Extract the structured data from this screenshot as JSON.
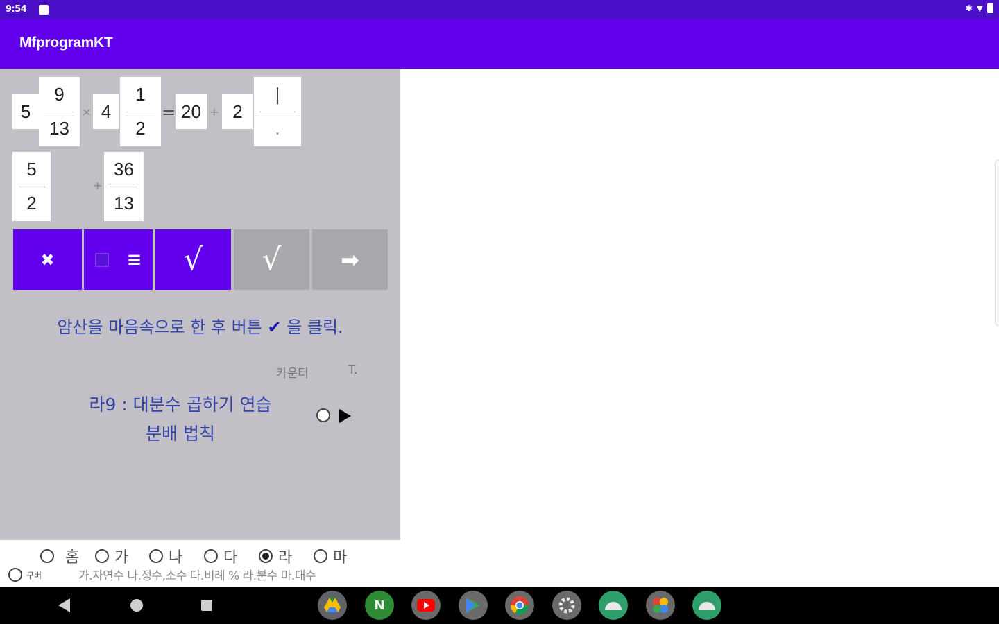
{
  "status_bar": {
    "time": "9:54"
  },
  "app": {
    "title": "MfprogramKT"
  },
  "equation": {
    "lhs1": {
      "whole": "5",
      "num": "9",
      "den": "13"
    },
    "times": "×",
    "lhs2": {
      "whole": "4",
      "num": "1",
      "den": "2"
    },
    "equals": "=",
    "result_whole": "20",
    "plus": "+",
    "rhs": {
      "whole": "2",
      "num": "|",
      "den": "."
    },
    "row2_frac1": {
      "num": "5",
      "den": "2"
    },
    "row2_plus": "+",
    "row2_frac2": {
      "num": "36",
      "den": "13"
    }
  },
  "buttons": {
    "clear": "✖",
    "menu": "≡",
    "check": "√",
    "check2": "√",
    "next": "➡"
  },
  "hint": {
    "text_before": "암산을 마음속으로 한 후 버튼",
    "check_mark": "✔",
    "text_after": "을 클릭."
  },
  "labels": {
    "counter": "카운터",
    "t": "T."
  },
  "lesson": {
    "line1": "라9 : 대분수 곱하기 연습",
    "line2": "분배 법칙"
  },
  "categories": [
    {
      "label": "홈",
      "checked": false
    },
    {
      "label": "가",
      "checked": false
    },
    {
      "label": "나",
      "checked": false
    },
    {
      "label": "다",
      "checked": false
    },
    {
      "label": "라",
      "checked": true
    },
    {
      "label": "마",
      "checked": false
    }
  ],
  "small_option": "구버",
  "legend": "가.자연수 나.정수,소수 다.비례 % 라.분수 마.대수",
  "dock": [
    {
      "name": "drive-icon",
      "color": "#5f6368"
    },
    {
      "name": "n-app-icon",
      "label": "N",
      "color": "#2e8b35"
    },
    {
      "name": "youtube-icon",
      "color": "#6a6a6a"
    },
    {
      "name": "play-store-icon",
      "color": "#6a6a6a"
    },
    {
      "name": "chrome-icon",
      "color": "#6a6a6a"
    },
    {
      "name": "settings-icon",
      "color": "#6a6a6a"
    },
    {
      "name": "android-app-icon-1",
      "color": "#2e9e6a"
    },
    {
      "name": "photos-icon",
      "color": "#6a6a6a"
    },
    {
      "name": "android-app-icon-2",
      "color": "#2e9e6a"
    }
  ]
}
